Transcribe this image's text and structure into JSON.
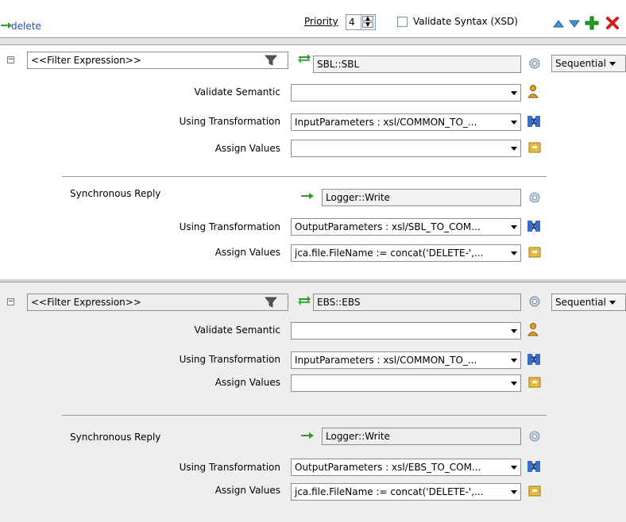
{
  "toolbar": {
    "delete_label": "delete",
    "priority_label": "Priority",
    "priority_value": "4",
    "validate_syntax_label": "Validate Syntax (XSD)",
    "validate_syntax_checked": false,
    "icons": [
      "green-arrow-icon",
      "move-up-icon",
      "move-down-icon",
      "add-icon",
      "delete-icon"
    ]
  },
  "rules": [
    {
      "filter": "<<Filter Expression>>",
      "target": "SBL::SBL",
      "execution": "Sequential",
      "validate_semantic_label": "Validate Semantic",
      "validate_semantic_value": "",
      "using_transformation_label": "Using Transformation",
      "using_transformation_value": "InputParameters : xsl/COMMON_TO_...",
      "assign_values_label": "Assign Values",
      "assign_values_value": "",
      "reply": {
        "label": "Synchronous Reply",
        "target": "Logger::Write",
        "using_transformation_label": "Using Transformation",
        "using_transformation_value": "OutputParameters : xsl/SBL_TO_COM...",
        "assign_values_label": "Assign Values",
        "assign_values_value": "jca.file.FileName := concat('DELETE-',..."
      }
    },
    {
      "filter": "<<Filter Expression>>",
      "target": "EBS::EBS",
      "execution": "Sequential",
      "validate_semantic_label": "Validate Semantic",
      "validate_semantic_value": "",
      "using_transformation_label": "Using Transformation",
      "using_transformation_value": "InputParameters : xsl/COMMON_TO_...",
      "assign_values_label": "Assign Values",
      "assign_values_value": "",
      "reply": {
        "label": "Synchronous Reply",
        "target": "Logger::Write",
        "using_transformation_label": "Using Transformation",
        "using_transformation_value": "OutputParameters : xsl/EBS_TO_COM...",
        "assign_values_label": "Assign Values",
        "assign_values_value": "jca.file.FileName := concat('DELETE-',..."
      }
    }
  ],
  "colors": {
    "link": "#1f4fb0",
    "panel2_bg": "#eeeeee",
    "arrow_green": "#2aa02a",
    "add_green": "#22a022",
    "delete_red": "#d02020"
  }
}
